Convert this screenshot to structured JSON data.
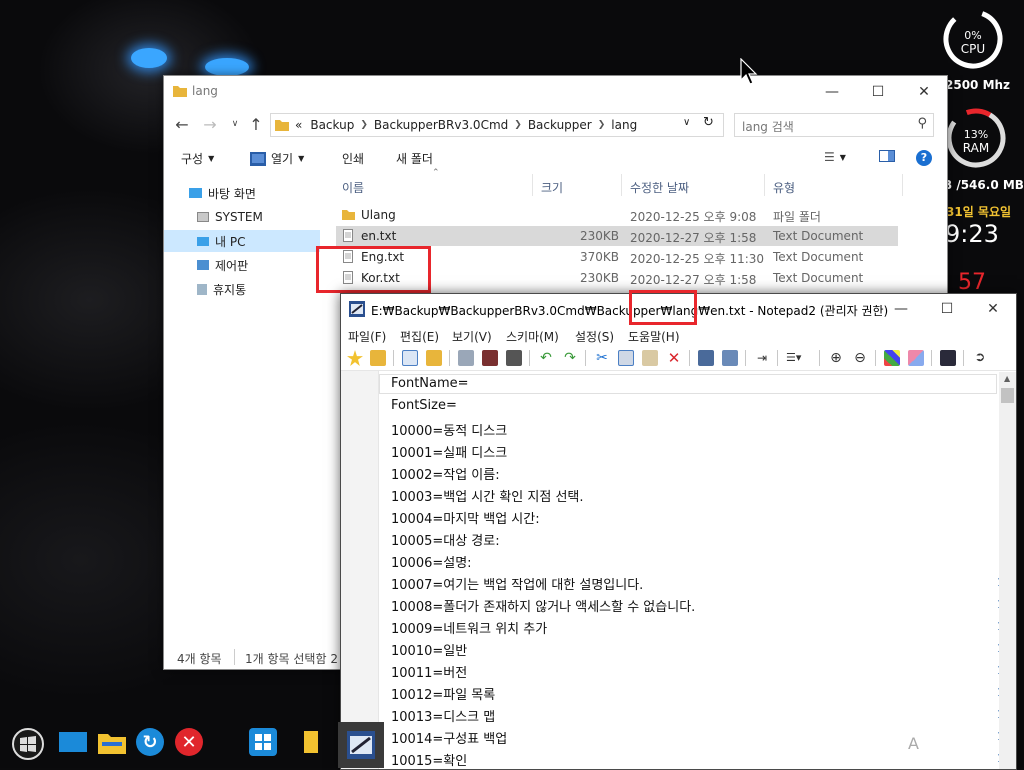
{
  "explorer": {
    "title": "lang",
    "path": [
      "Backup",
      "BackupperBRv3.0Cmd",
      "Backupper",
      "lang"
    ],
    "path_prefix": "«",
    "search_placeholder": "lang 검색",
    "commands": {
      "organize": "구성",
      "open": "열기",
      "print": "인쇄",
      "new_folder": "새 폴더"
    },
    "nav": [
      {
        "label": "바탕 화면",
        "icon": "desktop-icon"
      },
      {
        "label": "SYSTEM",
        "icon": "drive-icon"
      },
      {
        "label": "내 PC",
        "icon": "pc-icon"
      },
      {
        "label": "제어판",
        "icon": "control-panel-icon"
      },
      {
        "label": "휴지통",
        "icon": "recycle-bin-icon"
      }
    ],
    "columns": [
      "이름",
      "크기",
      "수정한 날짜",
      "유형"
    ],
    "files": [
      {
        "name": "Ulang",
        "size": "",
        "date": "2020-12-25 오후 9:08",
        "type": "파일 폴더",
        "icon": "folder"
      },
      {
        "name": "en.txt",
        "size": "230KB",
        "date": "2020-12-27 오후 1:58",
        "type": "Text Document",
        "icon": "txt"
      },
      {
        "name": "Eng.txt",
        "size": "370KB",
        "date": "2020-12-25 오후 11:30",
        "type": "Text Document",
        "icon": "txt"
      },
      {
        "name": "Kor.txt",
        "size": "230KB",
        "date": "2020-12-27 오후 1:58",
        "type": "Text Document",
        "icon": "txt"
      }
    ],
    "status_items": "4개 항목",
    "status_selected": "1개 항목 선택함 2"
  },
  "notepad": {
    "title": "E:₩Backup₩BackupperBRv3.0Cmd₩Backupper₩lang₩en.txt - Notepad2 (관리자 권한)",
    "menu": [
      "파일(F)",
      "편집(E)",
      "보기(V)",
      "스키마(M)",
      "설정(S)",
      "도움말(H)"
    ],
    "lines": [
      "FontName=",
      "FontSize=",
      "10000=동적 디스크",
      "10001=실패 디스크",
      "10002=작업 이름:",
      "10003=백업 시간 확인 지점 선택.",
      "10004=마지막 백업 시간:",
      "10005=대상 경로:",
      "10006=설명:",
      "10007=여기는 백업 작업에 대한 설명입니다.",
      "10008=폴더가 존재하지 않거나 액세스할 수 없습니다.",
      "10009=네트워크 위치 추가",
      "10010=일반",
      "10011=버전",
      "10012=파일 목록",
      "10013=디스크 맵",
      "10014=구성표 백업",
      "10015=확인"
    ]
  },
  "gadgets": {
    "cpu_percent": "0%",
    "cpu_label": "CPU",
    "cpu_freq": "2500 Mhz",
    "ram_percent": "13%",
    "ram_label": "RAM",
    "ram_text": "B /546.0 MB",
    "date_text": "31일 목요일",
    "time_text": "9:23",
    "seconds_text": "57",
    "cpu_usage": 0.0,
    "ram_usage": 0.13
  },
  "taskbar": {
    "icons": [
      "start-orb-icon",
      "desktop-monitor-icon",
      "file-explorer-icon",
      "refresh-icon",
      "close-red-icon",
      "windows-store-icon",
      "folder-icon",
      "notepad2-icon"
    ],
    "tray_glyph": "A"
  },
  "colors": {
    "highlight_red": "#e8262c",
    "selection_gray": "#d9d9d9",
    "nav_selected": "#cce8ff",
    "line_number_blue": "#1b5ca8"
  }
}
